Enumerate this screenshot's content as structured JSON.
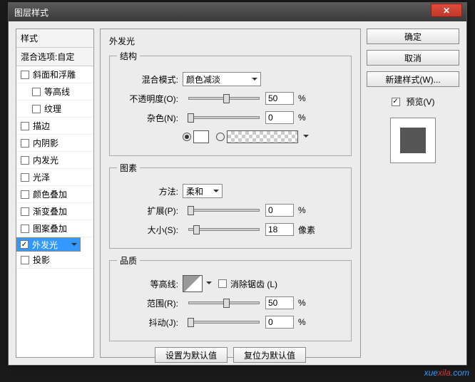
{
  "window": {
    "title": "图层样式",
    "close": "✕"
  },
  "sidebar": {
    "header": "样式",
    "subheader": "混合选项:自定",
    "items": [
      {
        "label": "斜面和浮雕",
        "checked": false,
        "indent": false
      },
      {
        "label": "等高线",
        "checked": false,
        "indent": true
      },
      {
        "label": "纹理",
        "checked": false,
        "indent": true
      },
      {
        "label": "描边",
        "checked": false,
        "indent": false
      },
      {
        "label": "内阴影",
        "checked": false,
        "indent": false
      },
      {
        "label": "内发光",
        "checked": false,
        "indent": false
      },
      {
        "label": "光泽",
        "checked": false,
        "indent": false
      },
      {
        "label": "颜色叠加",
        "checked": false,
        "indent": false
      },
      {
        "label": "渐变叠加",
        "checked": false,
        "indent": false
      },
      {
        "label": "图案叠加",
        "checked": false,
        "indent": false
      },
      {
        "label": "外发光",
        "checked": true,
        "indent": false,
        "selected": true
      },
      {
        "label": "投影",
        "checked": false,
        "indent": false
      }
    ]
  },
  "panel": {
    "title": "外发光",
    "structure": {
      "legend": "结构",
      "blend_label": "混合模式:",
      "blend_value": "颜色减淡",
      "opacity_label": "不透明度(O):",
      "opacity_value": "50",
      "opacity_unit": "%",
      "noise_label": "杂色(N):",
      "noise_value": "0",
      "noise_unit": "%"
    },
    "elements": {
      "legend": "图素",
      "technique_label": "方法:",
      "technique_value": "柔和",
      "spread_label": "扩展(P):",
      "spread_value": "0",
      "spread_unit": "%",
      "size_label": "大小(S):",
      "size_value": "18",
      "size_unit": "像素"
    },
    "quality": {
      "legend": "品质",
      "contour_label": "等高线:",
      "antialias_label": "消除锯齿 (L)",
      "range_label": "范围(R):",
      "range_value": "50",
      "range_unit": "%",
      "jitter_label": "抖动(J):",
      "jitter_value": "0",
      "jitter_unit": "%"
    },
    "defaults": {
      "set": "设置为默认值",
      "reset": "复位为默认值"
    }
  },
  "actions": {
    "ok": "确定",
    "cancel": "取消",
    "new_style": "新建样式(W)...",
    "preview_label": "预览(V)",
    "preview_checked": true
  },
  "watermark": {
    "a": "xue",
    "b": "xila",
    "c": ".com"
  }
}
